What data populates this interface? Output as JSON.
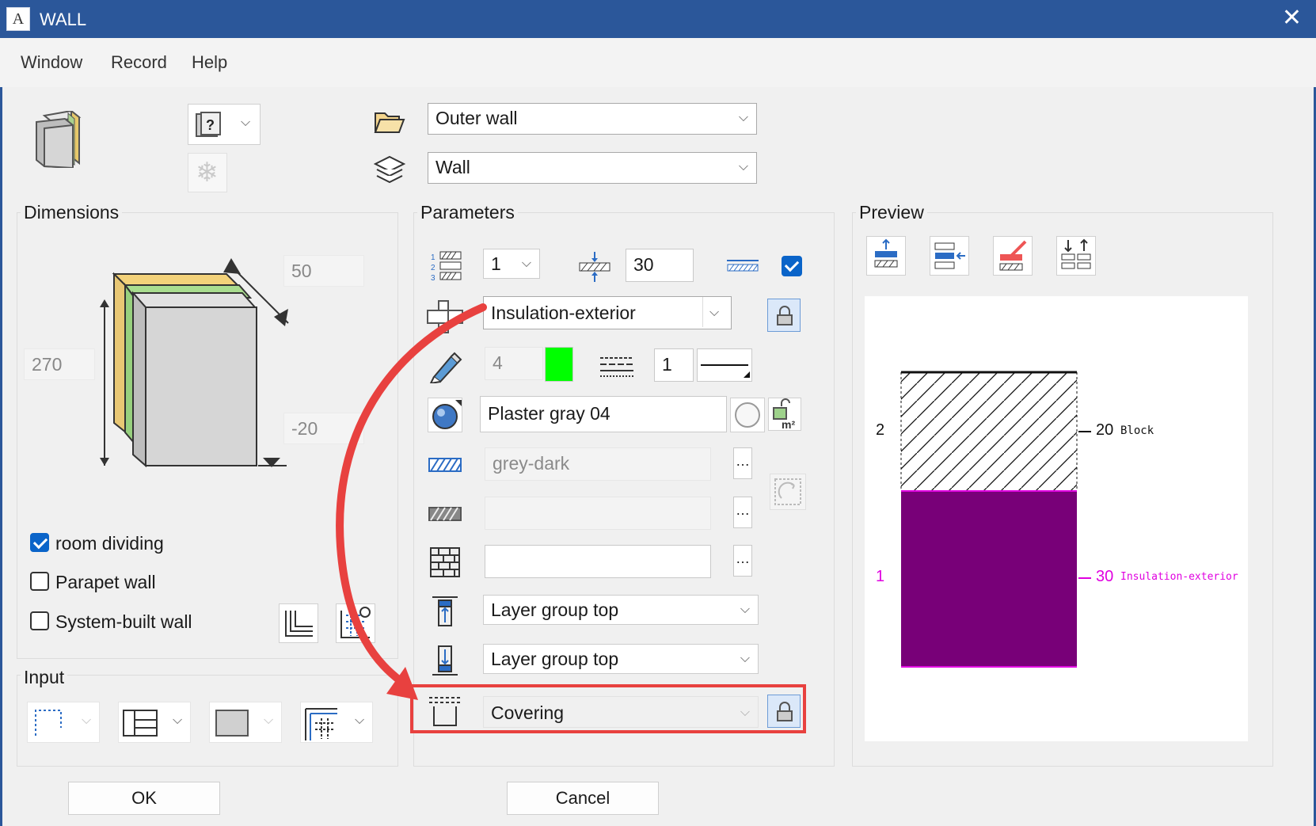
{
  "window": {
    "title": "WALL",
    "close_glyph": "✕",
    "app_icon_letter": "A"
  },
  "menu": [
    "Window",
    "Record",
    "Help"
  ],
  "top": {
    "category_value": "Outer wall",
    "type_value": "Wall"
  },
  "dimensions": {
    "title": "Dimensions",
    "thickness": "50",
    "height": "270",
    "offset": "-20",
    "checks": [
      {
        "label": "room dividing",
        "checked": true
      },
      {
        "label": "Parapet wall",
        "checked": false
      },
      {
        "label": "System-built wall",
        "checked": false
      }
    ]
  },
  "input": {
    "title": "Input"
  },
  "parameters": {
    "title": "Parameters",
    "layer_number": "1",
    "layer_thickness": "30",
    "layer_checkbox": true,
    "material_value": "Insulation-exterior",
    "pen_value": "4",
    "color_swatch": "#00ff00",
    "line_value": "1",
    "surface_value": "Plaster gray 04",
    "hatch_value": "grey-dark",
    "pattern_value": "",
    "fill_value": "",
    "top_constraint": "Layer group top",
    "bottom_constraint": "Layer group top",
    "covering_value": "Covering"
  },
  "preview": {
    "title": "Preview",
    "layers": [
      {
        "index": "2",
        "thickness": "20",
        "name": "Block",
        "color": "#000000"
      },
      {
        "index": "1",
        "thickness": "30",
        "name": "Insulation-exterior",
        "color": "#e000e0"
      }
    ],
    "fill_color": "#780078"
  },
  "buttons": {
    "ok": "OK",
    "cancel": "Cancel"
  },
  "colors": {
    "titlebar": "#2b579a",
    "highlight": "#e8413f",
    "accent": "#0a64c9"
  }
}
